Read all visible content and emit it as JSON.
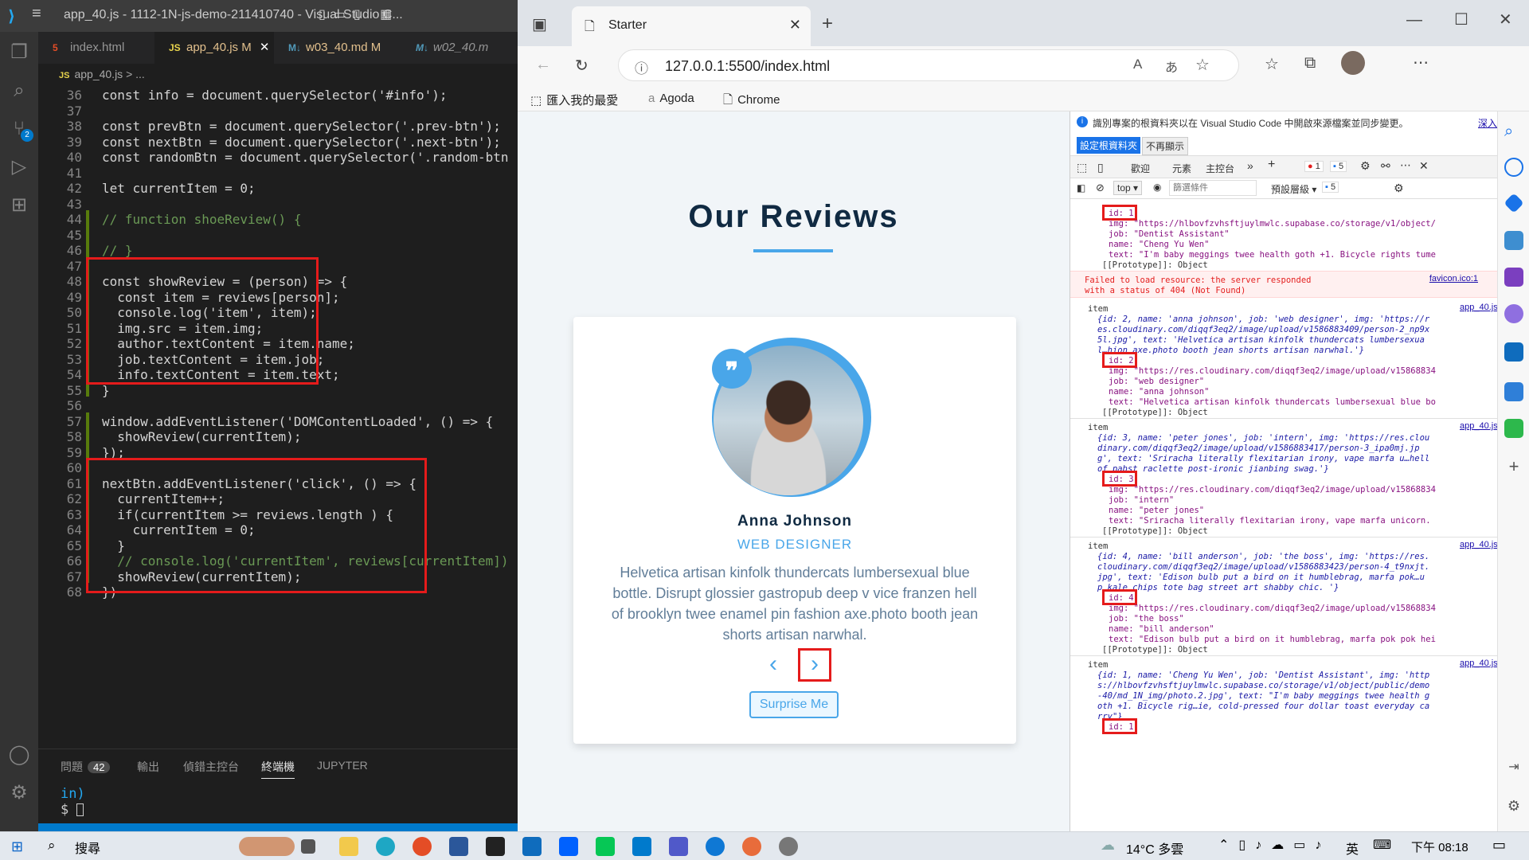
{
  "vscode": {
    "window_title": "app_40.js - 1112-1N-js-demo-211410740 - Visual Studio C...",
    "tabs": [
      {
        "label": "index.html",
        "status": ""
      },
      {
        "label": "app_40.js",
        "status": "M"
      },
      {
        "label": "w03_40.md",
        "status": "M"
      },
      {
        "label": "w02_40.m",
        "status": ""
      }
    ],
    "breadcrumb": "app_40.js > ...",
    "code_lines": [
      {
        "n": "36",
        "text": "const info = document.querySelector('#info');"
      },
      {
        "n": "37",
        "text": ""
      },
      {
        "n": "38",
        "text": "const prevBtn = document.querySelector('.prev-btn');"
      },
      {
        "n": "39",
        "text": "const nextBtn = document.querySelector('.next-btn');"
      },
      {
        "n": "40",
        "text": "const randomBtn = document.querySelector('.random-btn"
      },
      {
        "n": "41",
        "text": ""
      },
      {
        "n": "42",
        "text": "let currentItem = 0;"
      },
      {
        "n": "43",
        "text": ""
      },
      {
        "n": "44",
        "text": "// function shoeReview() {"
      },
      {
        "n": "45",
        "text": ""
      },
      {
        "n": "46",
        "text": "// }"
      },
      {
        "n": "47",
        "text": ""
      },
      {
        "n": "48",
        "text": "const showReview = (person) => {"
      },
      {
        "n": "49",
        "text": "  const item = reviews[person];"
      },
      {
        "n": "50",
        "text": "  console.log('item', item);"
      },
      {
        "n": "51",
        "text": "  img.src = item.img;"
      },
      {
        "n": "52",
        "text": "  author.textContent = item.name;"
      },
      {
        "n": "53",
        "text": "  job.textContent = item.job;"
      },
      {
        "n": "54",
        "text": "  info.textContent = item.text;"
      },
      {
        "n": "55",
        "text": "}"
      },
      {
        "n": "56",
        "text": ""
      },
      {
        "n": "57",
        "text": "window.addEventListener('DOMContentLoaded', () => {"
      },
      {
        "n": "58",
        "text": "  showReview(currentItem);"
      },
      {
        "n": "59",
        "text": "});"
      },
      {
        "n": "60",
        "text": ""
      },
      {
        "n": "61",
        "text": "nextBtn.addEventListener('click', () => {"
      },
      {
        "n": "62",
        "text": "  currentItem++;"
      },
      {
        "n": "63",
        "text": "  if(currentItem >= reviews.length ) {"
      },
      {
        "n": "64",
        "text": "    currentItem = 0;"
      },
      {
        "n": "65",
        "text": "  }"
      },
      {
        "n": "66",
        "text": "  // console.log('currentItem', reviews[currentItem])"
      },
      {
        "n": "67",
        "text": "  showReview(currentItem);"
      },
      {
        "n": "68",
        "text": "})"
      }
    ],
    "panel_tabs": [
      "問題",
      "輸出",
      "偵錯主控台",
      "終端機",
      "JUPYTER"
    ],
    "problems_count": "42",
    "terminal_lines": [
      "in)",
      "$ "
    ],
    "scm_badge": "2"
  },
  "browser": {
    "tab_title": "Starter",
    "url": "127.0.0.1:5500/index.html",
    "bookmarks": [
      "匯入我的最愛",
      "Agoda",
      "Chrome"
    ],
    "page": {
      "title": "Our Reviews",
      "author": "Anna Johnson",
      "job": "web designer",
      "info": "Helvetica artisan kinfolk thundercats lumbersexual blue bottle. Disrupt glossier gastropub deep v vice franzen hell of brooklyn twee enamel pin fashion axe.photo booth jean shorts artisan narwhal.",
      "prev_icon": "‹",
      "next_icon": "›",
      "random_label": "Surprise Me"
    }
  },
  "devtools": {
    "notice": "識別專案的根資料夾以在 Visual Studio Code 中開啟來源檔案並同步變更。",
    "learn_more": "深入了解",
    "set_root_btn": "設定根資料夾",
    "dont_show_btn": "不再顯示",
    "tabs": [
      "歡迎",
      "元素",
      "主控台"
    ],
    "error_count": "1",
    "info_count": "5",
    "context": "top",
    "filter_placeholder": "篩選條件",
    "levels": "預設層級",
    "levels_count": "5",
    "console": {
      "entry0": {
        "id": "id: 1",
        "img": "img: \"https://hlbovfzvhsftjuylmwlc.supabase.co/storage/v1/object/",
        "job": "job: \"Dentist Assistant\"",
        "name": "name: \"Cheng Yu Wen\"",
        "text": "text: \"I'm baby meggings twee health goth +1. Bicycle rights tume",
        "proto": "[[Prototype]]: Object"
      },
      "error": {
        "line1": "Failed to load resource: the server responded",
        "line2": "with a status of 404 (Not Found)",
        "src": "favicon.ico:1"
      },
      "entry2": {
        "label": "item",
        "src": "app_40.js:50",
        "s1": "{id: 2, name: 'anna johnson', job: 'web designer', img: 'https://r",
        "s2": "es.cloudinary.com/diqqf3eq2/image/upload/v1586883409/person-2_np9x",
        "s3": "5l.jpg', text: 'Helvetica artisan kinfolk thundercats lumbersexua",
        "s4": "l…hion axe.photo booth jean shorts artisan narwhal.'}",
        "id": "id: 2",
        "img": "img: \"https://res.cloudinary.com/diqqf3eq2/image/upload/v15868834",
        "job": "job: \"web designer\"",
        "name": "name: \"anna johnson\"",
        "text": "text: \"Helvetica artisan kinfolk thundercats lumbersexual blue bo",
        "proto": "[[Prototype]]: Object"
      },
      "entry3": {
        "label": "item",
        "src": "app_40.js:50",
        "s1": "{id: 3, name: 'peter jones', job: 'intern', img: 'https://res.clou",
        "s2": "dinary.com/diqqf3eq2/image/upload/v1586883417/person-3_ipa0mj.jp",
        "s3": "g', text: 'Sriracha literally flexitarian irony, vape marfa u…hell",
        "s4": "of pabst raclette post-ironic jianbing swag.'}",
        "id": "id: 3",
        "img": "img: \"https://res.cloudinary.com/diqqf3eq2/image/upload/v15868834",
        "job": "job: \"intern\"",
        "name": "name: \"peter jones\"",
        "text": "text: \"Sriracha literally flexitarian irony, vape marfa unicorn.",
        "proto": "[[Prototype]]: Object"
      },
      "entry4": {
        "label": "item",
        "src": "app_40.js:50",
        "s1": "{id: 4, name: 'bill anderson', job: 'the boss', img: 'https://res.",
        "s2": "cloudinary.com/diqqf3eq2/image/upload/v1586883423/person-4_t9nxjt.",
        "s3": "jpg', text: 'Edison bulb put a bird on it humblebrag, marfa pok…u",
        "s4": "p kale chips tote bag street art shabby chic. '}",
        "id": "id: 4",
        "img": "img: \"https://res.cloudinary.com/diqqf3eq2/image/upload/v15868834",
        "job": "job: \"the boss\"",
        "name": "name: \"bill anderson\"",
        "text": "text: \"Edison bulb put a bird on it humblebrag, marfa pok pok hei",
        "proto": "[[Prototype]]: Object"
      },
      "entry5": {
        "label": "item",
        "src": "app_40.js:50",
        "s1": "{id: 1, name: 'Cheng Yu Wen', job: 'Dentist Assistant', img: 'http",
        "s2": "s://hlbovfzvhsftjuylmwlc.supabase.co/storage/v1/object/public/demo",
        "s3": "-40/md_1N_img/photo.2.jpg', text: \"I'm baby meggings twee health g",
        "s4": "oth +1. Bicycle rig…ie, cold-pressed four dollar toast everyday ca",
        "s5": "rry\"}",
        "id": "id: 1"
      }
    }
  },
  "taskbar": {
    "search": "搜尋",
    "weather": "14°C 多雲",
    "ime": "英",
    "time": "下午 08:18"
  },
  "colors": {
    "accent": "#49a6e9",
    "title": "#102a42",
    "highlight": "#e51b1b",
    "vscode_bg": "#1e1e1e"
  }
}
